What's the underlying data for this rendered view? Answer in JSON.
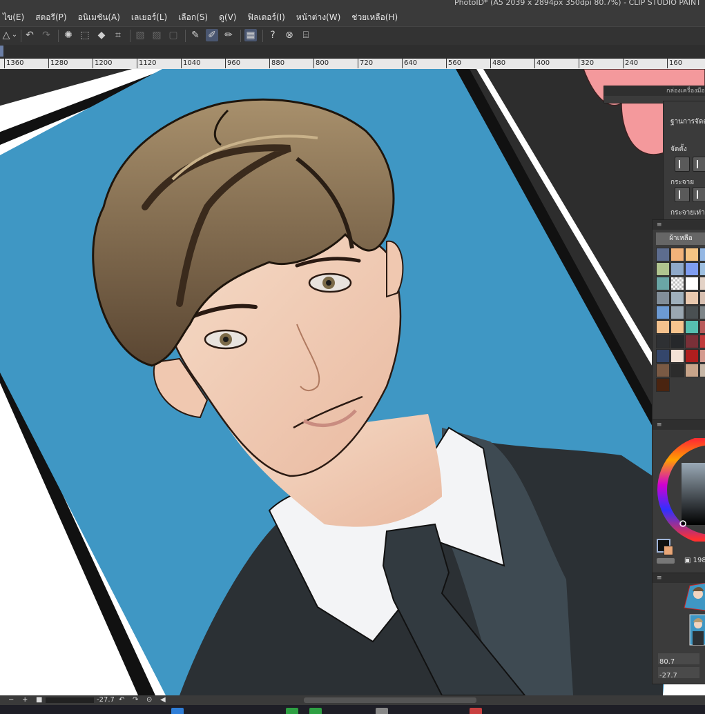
{
  "window": {
    "title": "PhotoID* (A5 2039 x 2894px 350dpi 80.7%)  - CLIP STUDIO PAINT"
  },
  "menu": [
    "ไข(E)",
    "สตอรี(P)",
    "อนิเมชัน(A)",
    "เลเยอร์(L)",
    "เลือก(S)",
    "ดู(V)",
    "ฟิลเตอร์(I)",
    "หน้าต่าง(W)",
    "ช่วยเหลือ(H)"
  ],
  "toolbar": {
    "icons": [
      "transform-icon",
      "undo-icon",
      "redo-icon",
      "lasso-icon",
      "fill-icon",
      "marquee-icon",
      "crop-icon",
      "hatch-icon",
      "grid-icon",
      "frame-icon",
      "pen-icon",
      "brush-icon",
      "eraser-icon",
      "tablet-icon",
      "help-icon",
      "navigate-icon",
      "settings-icon"
    ]
  },
  "ruler": {
    "ticks": [
      "1360",
      "1280",
      "1200",
      "1120",
      "1040",
      "960",
      "880",
      "800",
      "720",
      "640",
      "560",
      "480",
      "400",
      "320",
      "240",
      "160"
    ]
  },
  "tool_panel": {
    "title": "กล่องเครื่องมือ",
    "subtitle": "ฐานการจัดตั้ง",
    "align_label": "จัดตั้ง",
    "distribute_label": "กระจาย",
    "distribute_even_label": "กระจายเท่า"
  },
  "color_set": {
    "title": "ผ้าเหลือ",
    "swatches": [
      "#5d6d8f",
      "#f2b37a",
      "#f6c483",
      "#94b7e3",
      "#b0c48f",
      "#8fa9c9",
      "#7f9df0",
      "#9ebfe0",
      "#6aa6a6",
      "checker",
      "#ffffff",
      "#e3d2c6",
      "#828e99",
      "#9fb0bc",
      "#e9c9af",
      "#d7bfb0",
      "#6c9ad3",
      "#9aa7b1",
      "#4a5052",
      "#7d8488",
      "#f3c18d",
      "#f7c48e",
      "#56bfb0",
      "#b95a5a",
      "#2e3033",
      "#26282b",
      "#7a3038",
      "#c23a3a",
      "#34466b",
      "#f4e2d6",
      "#b01e1e",
      "#d49a8e",
      "#7a5a44",
      "#2c2c2c",
      "#c8a48a",
      "#c6b6a6",
      "#4a2410"
    ]
  },
  "color_wheel": {
    "main_color": "#111111",
    "sub_color": "#e9a677",
    "size_value": "198"
  },
  "layers": {
    "opacity": "80.7",
    "rotation": "-27.7"
  },
  "status": {
    "rotation": "-27.7"
  }
}
